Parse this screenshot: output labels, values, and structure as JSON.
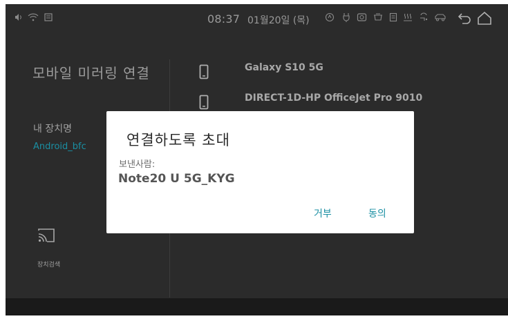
{
  "status_bar": {
    "time": "08:37",
    "date": "01월20일 (목)",
    "icons": [
      "volume-icon",
      "wifi-icon",
      "sd-card-icon",
      "media-icon",
      "charging-icon",
      "camera-icon",
      "seat-icon",
      "rear-defrost-icon",
      "seat-heat-icon",
      "fan-icon",
      "car-icon",
      "back-icon",
      "home-icon"
    ]
  },
  "left_panel": {
    "title": "모바일 미러링 연결",
    "device_name_label": "내 장치명",
    "device_name_value": "Android_bfc",
    "search_button_label": "장치검색"
  },
  "device_list": [
    {
      "label": "Galaxy S10 5G"
    },
    {
      "label": "DIRECT-1D-HP OfficeJet Pro 9010"
    }
  ],
  "dialog": {
    "title": "연결하도록 초대",
    "sender_label": "보낸사람:",
    "sender_name": "Note20 U 5G_KYG",
    "decline_label": "거부",
    "accept_label": "동의"
  },
  "colors": {
    "background": "#2b2b2b",
    "accent": "#1a8fa3",
    "dialog_background": "#ffffff"
  }
}
